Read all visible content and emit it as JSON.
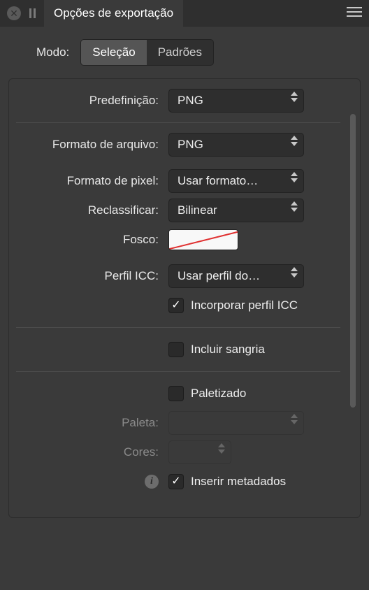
{
  "titlebar": {
    "tab_label": "Opções de exportação"
  },
  "mode": {
    "label": "Modo:",
    "options": [
      "Seleção",
      "Padrões"
    ],
    "active_index": 0
  },
  "rows": {
    "preset": {
      "label": "Predefinição:",
      "value": "PNG"
    },
    "file_format": {
      "label": "Formato de arquivo:",
      "value": "PNG"
    },
    "pixel_format": {
      "label": "Formato de pixel:",
      "value": "Usar formato…"
    },
    "resample": {
      "label": "Reclassificar:",
      "value": "Bilinear"
    },
    "matte": {
      "label": "Fosco:"
    },
    "icc_profile": {
      "label": "Perfil ICC:",
      "value": "Usar perfil do…",
      "checkbox_label": "Incorporar perfil ICC",
      "checked": true
    },
    "bleed": {
      "checkbox_label": "Incluir sangria",
      "checked": false
    },
    "palettised": {
      "checkbox_label": "Paletizado",
      "checked": false
    },
    "palette": {
      "label": "Paleta:",
      "value": ""
    },
    "colors": {
      "label": "Cores:",
      "value": ""
    },
    "metadata": {
      "checkbox_label": "Inserir metadados",
      "checked": true
    }
  }
}
